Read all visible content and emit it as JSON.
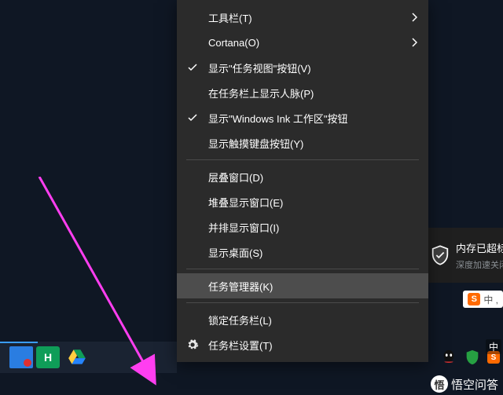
{
  "menu": {
    "items": [
      {
        "label": "工具栏(T)",
        "submenu": true
      },
      {
        "label": "Cortana(O)",
        "submenu": true
      },
      {
        "label": "显示\"任务视图\"按钮(V)",
        "checked": true
      },
      {
        "label": "在任务栏上显示人脉(P)"
      },
      {
        "label": "显示\"Windows Ink 工作区\"按钮",
        "checked": true
      },
      {
        "label": "显示触摸键盘按钮(Y)"
      },
      {
        "sep": true
      },
      {
        "label": "层叠窗口(D)"
      },
      {
        "label": "堆叠显示窗口(E)"
      },
      {
        "label": "并排显示窗口(I)"
      },
      {
        "label": "显示桌面(S)"
      },
      {
        "sep": true
      },
      {
        "label": "任务管理器(K)",
        "highlight": true
      },
      {
        "sep": true
      },
      {
        "label": "锁定任务栏(L)"
      },
      {
        "label": "任务栏设置(T)",
        "gear": true
      }
    ]
  },
  "toast": {
    "title": "内存已超标,",
    "subtitle": "深度加速关闭卡慢进程"
  },
  "sogou": {
    "badge": "S",
    "text": "中 ,"
  },
  "watermark": {
    "text": "悟空问答",
    "mid": "中"
  },
  "taskbar": {
    "h_label": "H"
  }
}
